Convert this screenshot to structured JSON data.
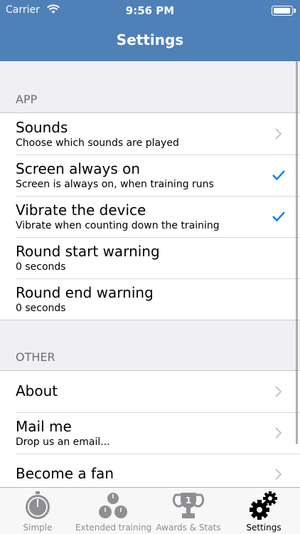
{
  "status_bar": {
    "carrier": "Carrier",
    "time": "9:56 PM",
    "battery_level": 1.0
  },
  "nav": {
    "title": "Settings"
  },
  "sections": [
    {
      "header": "APP",
      "rows": [
        {
          "title": "Sounds",
          "subtitle": "Choose which sounds are played",
          "accessory": "chevron-right-icon"
        },
        {
          "title": "Screen always on",
          "subtitle": "Screen is always on, when training runs",
          "accessory": "checkmark-icon"
        },
        {
          "title": "Vibrate the device",
          "subtitle": "Vibrate when counting down the training",
          "accessory": "checkmark-icon"
        },
        {
          "title": "Round start warning",
          "subtitle": "0 seconds",
          "accessory": "none"
        },
        {
          "title": "Round end warning",
          "subtitle": "0 seconds",
          "accessory": "none"
        }
      ]
    },
    {
      "header": "OTHER",
      "rows": [
        {
          "title": "About",
          "subtitle": "",
          "accessory": "chevron-right-icon"
        },
        {
          "title": "Mail me",
          "subtitle": "Drop us an email...",
          "accessory": "chevron-right-icon"
        },
        {
          "title": "Become a fan",
          "subtitle": "",
          "accessory": "chevron-right-icon"
        }
      ]
    }
  ],
  "tabbar": {
    "tabs": [
      {
        "label": "Simple",
        "icon": "stopwatch-icon",
        "active": false
      },
      {
        "label": "Extended training",
        "icon": "multi-timer-icon",
        "active": false
      },
      {
        "label": "Awards & Stats",
        "icon": "trophy-icon",
        "active": false
      },
      {
        "label": "Settings",
        "icon": "gears-icon",
        "active": true
      }
    ]
  },
  "colors": {
    "nav_background": "#4f80b8",
    "accent": "#007aff",
    "inactive_tab": "#8e8e93"
  }
}
